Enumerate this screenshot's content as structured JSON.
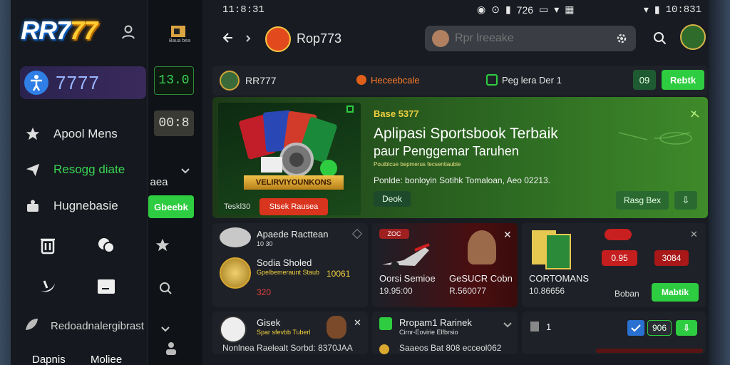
{
  "status": {
    "time_main": "11:8:31",
    "time_right": "10:831",
    "mid_text": "726"
  },
  "drawer": {
    "logo_main": "RR7",
    "logo_accent": "77",
    "brand_pill": "7777",
    "menu": [
      {
        "icon": "star-icon",
        "label": "Apool Mens",
        "active": false
      },
      {
        "icon": "send-icon",
        "label": "Resogg diate",
        "active": true
      },
      {
        "icon": "briefcase-icon",
        "label": "Hugnebasie",
        "active": false
      }
    ],
    "footer_label": "Redoadnalergibrast",
    "bottom_left": "Dapnis",
    "bottom_right": "Moliee"
  },
  "strip": {
    "top_label": "Baua bea",
    "box1": "13.0",
    "box2": "00:8",
    "text_aea": "aea",
    "btn_label": "Gbeebk"
  },
  "topbar": {
    "title": "Rop773",
    "search_placeholder": "Rpr lreeake"
  },
  "hero_head": {
    "brand": "RR777",
    "promo": "Heceebcale",
    "page_label": "Peg lera Der 1",
    "count_badge": "09",
    "cta": "Rebtk"
  },
  "hero": {
    "badge": "Base 5377",
    "title": "Aplipasi Sportsbook Terbaik",
    "subtitle": "paur Penggemar Taruhen",
    "small_line": "Pouiblcue bepmerus fecsentiaubie",
    "desc": "Ponlde: bonloyin Sotihk Tomaloan, Aeo 02213.",
    "btn_deok": "Deok",
    "art_banner": "VELIRVIYOUNKONS",
    "tickets": "Teskl30",
    "btn_stack": "Stsek Rausea",
    "right_btn": "Rasg Bex",
    "right_btn2": "⇩"
  },
  "cards": [
    {
      "title": "Apaede Racttean",
      "sub": "10 30",
      "label": "Sodia Sholed",
      "sub2": "Gpelbemeraunt Staub",
      "value": "10061",
      "price": "320"
    },
    {
      "tag": "ZOC",
      "left_label": "Oorsi Semioe",
      "left_value": "19.95:00",
      "right_label": "GeSUCR Cobn",
      "right_value": "R.560077"
    },
    {
      "label": "CORTOMANS",
      "value": "10.86656",
      "odd1": "0.95",
      "odd2": "3084",
      "mini": "Boban",
      "btn": "Mabtik"
    }
  ],
  "row2": [
    {
      "title": "Gisek",
      "sub": "Spar sfevbb Tuberl",
      "line": "Nonlnea Raelealt Sorbd: 8370JAA"
    },
    {
      "title": "Rropam1 Rarinek",
      "sub": "Cirnr-Eovirie Elfbrsio",
      "line": "Saaeos Bat 808 ecceol062"
    },
    {
      "num": "1",
      "chip1": "906",
      "chip2": "⇩"
    }
  ],
  "colors": {
    "accent_green": "#2ecc40",
    "bg": "#181b21",
    "drawer": "#15181e",
    "red": "#d9341d"
  }
}
